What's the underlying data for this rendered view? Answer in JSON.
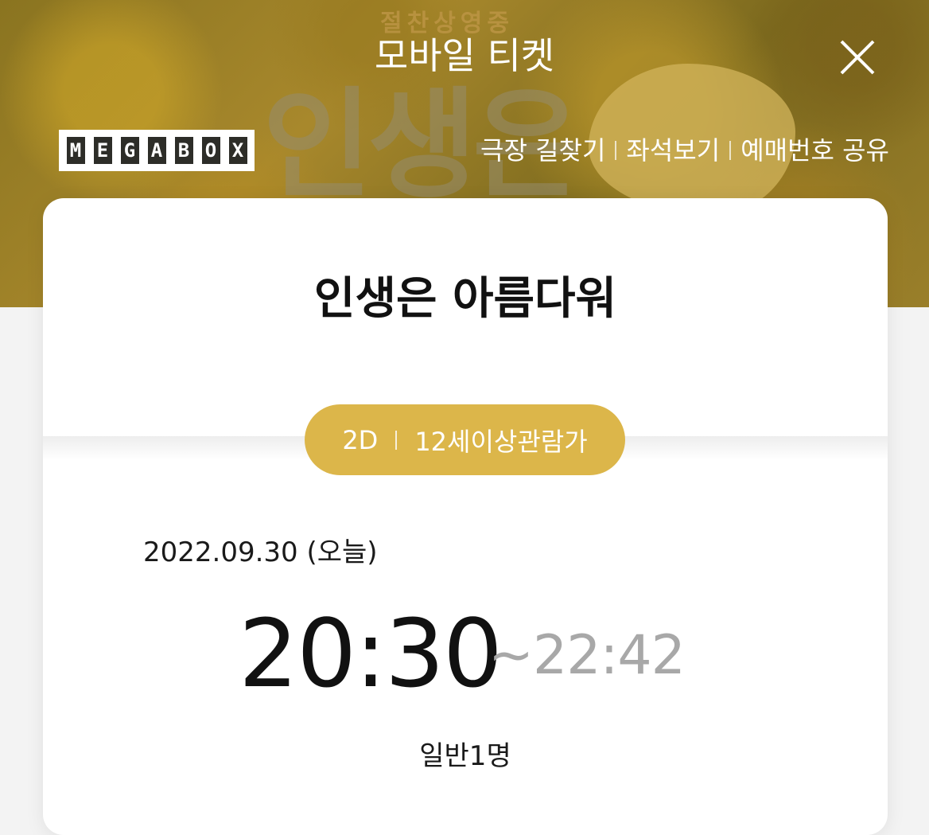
{
  "header": {
    "title": "모바일 티켓",
    "close_icon": "close-icon",
    "banner_sub_text": "절찬상영중",
    "banner_big_text": "인생은"
  },
  "brand": {
    "logo_text": "MEGABOX",
    "logo_letters": [
      "M",
      "E",
      "G",
      "A",
      "B",
      "O",
      "X"
    ]
  },
  "toplinks": {
    "directions": "극장 길찾기",
    "seats": "좌석보기",
    "share": "예매번호 공유"
  },
  "movie": {
    "title": "인생은 아름다워",
    "format": "2D",
    "rating": "12세이상관람가"
  },
  "showtime": {
    "date": "2022.09.30 (오늘)",
    "start": "20:30",
    "end": "~22:42",
    "people": "일반1명"
  },
  "colors": {
    "accent": "#dcb64a",
    "end_time": "#a8a8a8"
  }
}
